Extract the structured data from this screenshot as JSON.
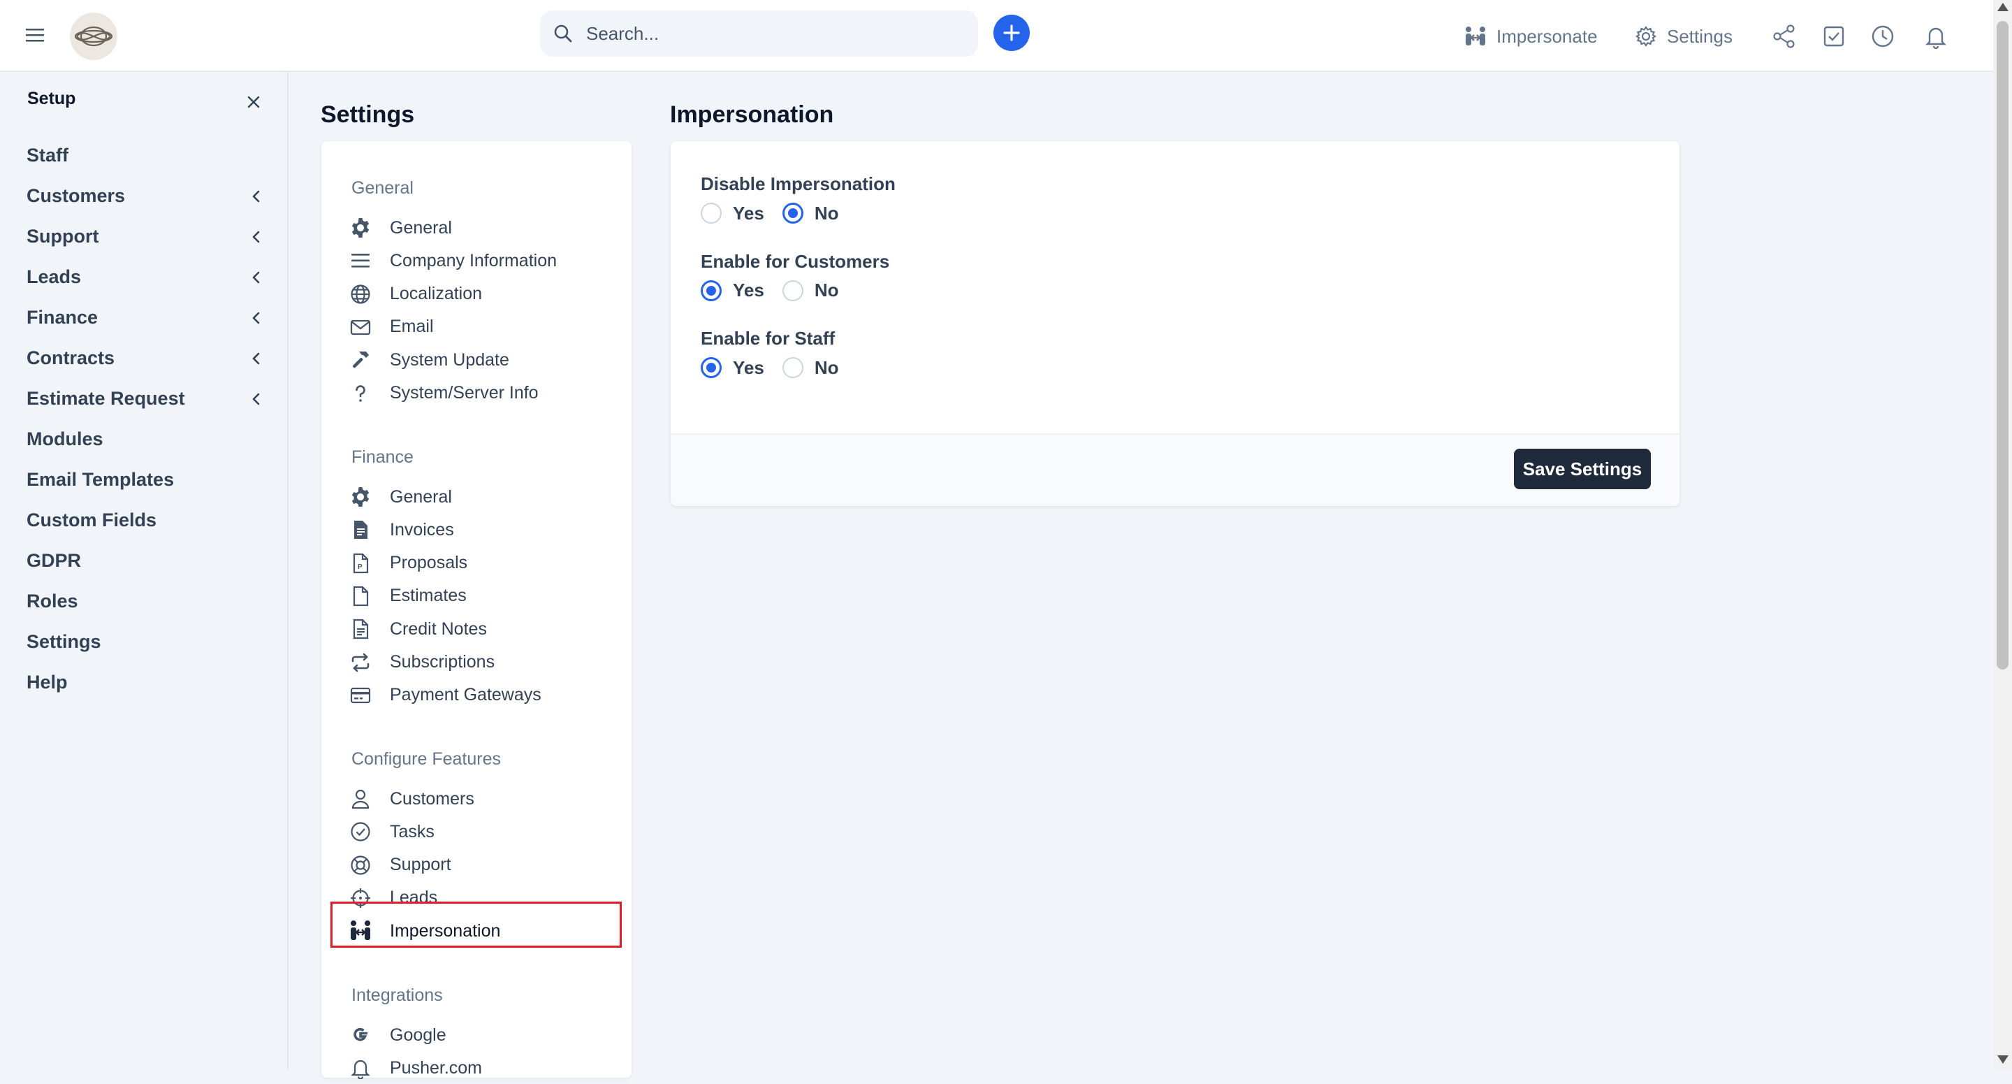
{
  "topbar": {
    "search_placeholder": "Search...",
    "impersonate_label": "Impersonate",
    "settings_label": "Settings",
    "brand_color": "#2563eb"
  },
  "sidebar": {
    "title": "Setup",
    "items": [
      {
        "label": "Staff",
        "has_children": false
      },
      {
        "label": "Customers",
        "has_children": true
      },
      {
        "label": "Support",
        "has_children": true
      },
      {
        "label": "Leads",
        "has_children": true
      },
      {
        "label": "Finance",
        "has_children": true
      },
      {
        "label": "Contracts",
        "has_children": true
      },
      {
        "label": "Estimate Request",
        "has_children": true
      },
      {
        "label": "Modules",
        "has_children": false
      },
      {
        "label": "Email Templates",
        "has_children": false
      },
      {
        "label": "Custom Fields",
        "has_children": false
      },
      {
        "label": "GDPR",
        "has_children": false
      },
      {
        "label": "Roles",
        "has_children": false
      },
      {
        "label": "Settings",
        "has_children": false
      },
      {
        "label": "Help",
        "has_children": false
      }
    ]
  },
  "settings_nav": {
    "title": "Settings",
    "groups": [
      {
        "label": "General",
        "items": [
          {
            "label": "General",
            "icon": "gear-icon"
          },
          {
            "label": "Company Information",
            "icon": "bars-icon"
          },
          {
            "label": "Localization",
            "icon": "globe-icon"
          },
          {
            "label": "Email",
            "icon": "envelope-icon"
          },
          {
            "label": "System Update",
            "icon": "hammer-icon"
          },
          {
            "label": "System/Server Info",
            "icon": "question-icon"
          }
        ]
      },
      {
        "label": "Finance",
        "items": [
          {
            "label": "General",
            "icon": "gear-icon"
          },
          {
            "label": "Invoices",
            "icon": "file-invoice-icon"
          },
          {
            "label": "Proposals",
            "icon": "file-proposal-icon"
          },
          {
            "label": "Estimates",
            "icon": "file-icon"
          },
          {
            "label": "Credit Notes",
            "icon": "file-lines-icon"
          },
          {
            "label": "Subscriptions",
            "icon": "repeat-icon"
          },
          {
            "label": "Payment Gateways",
            "icon": "credit-card-icon"
          }
        ]
      },
      {
        "label": "Configure Features",
        "items": [
          {
            "label": "Customers",
            "icon": "user-icon"
          },
          {
            "label": "Tasks",
            "icon": "check-circle-icon"
          },
          {
            "label": "Support",
            "icon": "life-ring-icon"
          },
          {
            "label": "Leads",
            "icon": "crosshairs-icon"
          },
          {
            "label": "Impersonation",
            "icon": "people-arrows-icon",
            "active": true
          }
        ]
      },
      {
        "label": "Integrations",
        "items": [
          {
            "label": "Google",
            "icon": "google-icon"
          },
          {
            "label": "Pusher.com",
            "icon": "bell-icon"
          }
        ]
      }
    ]
  },
  "content": {
    "title": "Impersonation",
    "fields": [
      {
        "label": "Disable Impersonation",
        "options": [
          "Yes",
          "No"
        ],
        "selected": "No"
      },
      {
        "label": "Enable for Customers",
        "options": [
          "Yes",
          "No"
        ],
        "selected": "Yes"
      },
      {
        "label": "Enable for Staff",
        "options": [
          "Yes",
          "No"
        ],
        "selected": "Yes"
      }
    ],
    "save_label": "Save Settings"
  }
}
